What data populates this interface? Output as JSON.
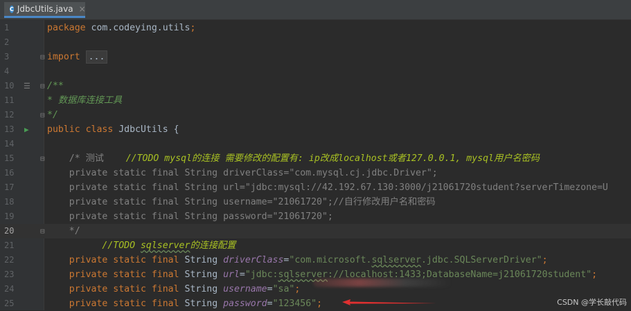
{
  "tab": {
    "icon_letter": "C",
    "filename": "JdbcUtils.java",
    "close": "×"
  },
  "lines": [
    {
      "n": "1",
      "parts": [
        [
          "kw",
          "package "
        ],
        [
          "tp",
          "com.codeying.utils"
        ],
        [
          "kw",
          ";"
        ]
      ]
    },
    {
      "n": "2",
      "parts": []
    },
    {
      "n": "3",
      "parts": [
        [
          "kw",
          "import "
        ],
        [
          "fold",
          "..."
        ]
      ]
    },
    {
      "n": "4",
      "parts": []
    },
    {
      "n": "10",
      "parts": [
        [
          "doc",
          "/**"
        ]
      ]
    },
    {
      "n": "11",
      "parts": [
        [
          "doc",
          "* 数据库连接工具"
        ]
      ]
    },
    {
      "n": "12",
      "parts": [
        [
          "doc",
          "*/"
        ]
      ]
    },
    {
      "n": "13",
      "parts": [
        [
          "kw",
          "public class "
        ],
        [
          "tp",
          "JdbcUtils {"
        ]
      ]
    },
    {
      "n": "14",
      "parts": []
    },
    {
      "n": "15",
      "parts": [
        [
          "gray",
          "    /* 测试    "
        ],
        [
          "todo",
          "//TODO mysql的连接 需要修改的配置有: ip改成localhost或者127.0.0.1, mysql用户名密码"
        ]
      ]
    },
    {
      "n": "16",
      "parts": [
        [
          "gray",
          "    private static final String driverClass=\"com.mysql.cj.jdbc.Driver\";"
        ]
      ]
    },
    {
      "n": "17",
      "parts": [
        [
          "gray",
          "    private static final String url=\"jdbc:mysql://42.192.67.130:3000/j21061720student?serverTimezone=U"
        ]
      ]
    },
    {
      "n": "18",
      "parts": [
        [
          "gray",
          "    private static final String username=\"21061720\";//自行修改用户名和密码"
        ]
      ]
    },
    {
      "n": "19",
      "parts": [
        [
          "gray",
          "    private static final String password=\"21061720\";"
        ]
      ]
    },
    {
      "n": "20",
      "parts": [
        [
          "gray",
          "    */"
        ]
      ]
    },
    {
      "n": "21",
      "parts": [
        [
          "tp",
          "          "
        ],
        [
          "todo",
          "//TODO "
        ],
        [
          "todo_sq",
          "sqlserver"
        ],
        [
          "todo",
          "的连接配置"
        ]
      ]
    },
    {
      "n": "22",
      "parts": [
        [
          "kw",
          "    private static final "
        ],
        [
          "tp",
          "String "
        ],
        [
          "fld",
          "driverClass"
        ],
        [
          "tp",
          "="
        ],
        [
          "str",
          "\"com.microsoft."
        ],
        [
          "str_sq",
          "sqlserver"
        ],
        [
          "str",
          ".jdbc.SQLServerDriver\""
        ],
        [
          "kw",
          ";"
        ]
      ]
    },
    {
      "n": "23",
      "parts": [
        [
          "kw",
          "    private static final "
        ],
        [
          "tp",
          "String "
        ],
        [
          "fld",
          "url"
        ],
        [
          "tp",
          "="
        ],
        [
          "str",
          "\"jdbc:"
        ],
        [
          "str_sq",
          "sqlserver"
        ],
        [
          "str",
          "://localhost:1433;DatabaseName=j21061720student\""
        ],
        [
          "kw",
          ";"
        ]
      ]
    },
    {
      "n": "24",
      "parts": [
        [
          "kw",
          "    private static final "
        ],
        [
          "tp",
          "String "
        ],
        [
          "fld",
          "username"
        ],
        [
          "tp",
          "="
        ],
        [
          "str",
          "\"sa\""
        ],
        [
          "kw",
          ";"
        ]
      ]
    },
    {
      "n": "25",
      "parts": [
        [
          "kw",
          "    private static final "
        ],
        [
          "tp",
          "String "
        ],
        [
          "fld",
          "password"
        ],
        [
          "tp",
          "="
        ],
        [
          "str",
          "\"123456\""
        ],
        [
          "kw",
          ";"
        ]
      ]
    }
  ],
  "current_line": "20",
  "watermark": "CSDN @学长敲代码"
}
